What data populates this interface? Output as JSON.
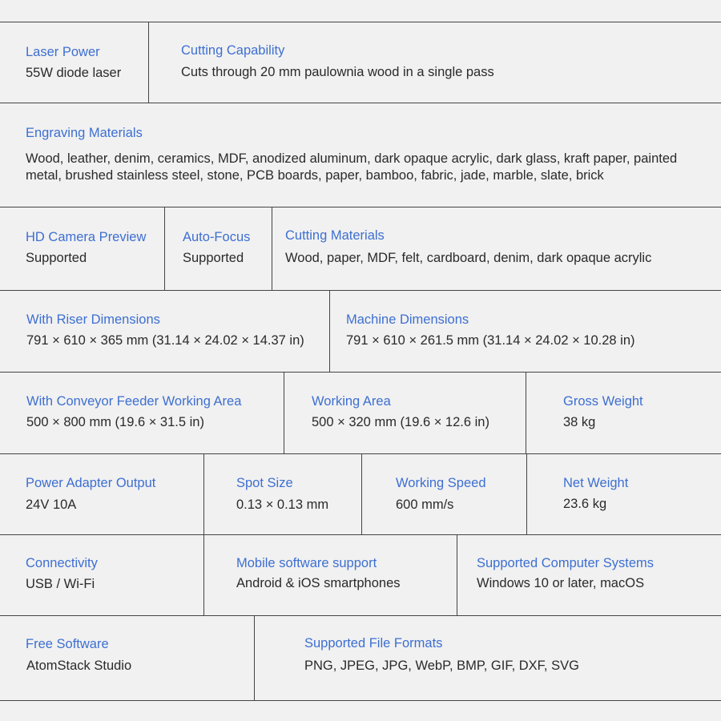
{
  "rows": [
    {
      "cells": [
        {
          "label": "Laser Power",
          "value": "55W diode laser"
        },
        {
          "label": "Cutting Capability",
          "value": "Cuts through 20 mm paulownia wood in a single pass"
        }
      ]
    },
    {
      "cells": [
        {
          "label": "Engraving Materials",
          "value": "Wood, leather, denim, ceramics, MDF, anodized aluminum, dark opaque acrylic, dark glass, kraft paper, painted metal, brushed stainless steel, stone, PCB boards, paper, bamboo, fabric, jade, marble, slate, brick"
        }
      ]
    },
    {
      "cells": [
        {
          "label": "HD Camera Preview",
          "value": "Supported"
        },
        {
          "label": "Auto-Focus",
          "value": "Supported"
        },
        {
          "label": "Cutting Materials",
          "value": "Wood, paper, MDF, felt, cardboard, denim, dark opaque acrylic"
        }
      ]
    },
    {
      "cells": [
        {
          "label": "With Riser Dimensions",
          "value": "791 × 610 × 365 mm (31.14 × 24.02 × 14.37 in)"
        },
        {
          "label": "Machine Dimensions",
          "value": "791 × 610 × 261.5 mm (31.14 × 24.02 × 10.28 in)"
        }
      ]
    },
    {
      "cells": [
        {
          "label": "With Conveyor Feeder Working Area",
          "value": "500 × 800 mm (19.6 × 31.5 in)"
        },
        {
          "label": "Working Area",
          "value": "500 × 320 mm (19.6 × 12.6 in)"
        },
        {
          "label": "Gross Weight",
          "value": "38 kg"
        }
      ]
    },
    {
      "cells": [
        {
          "label": "Power Adapter Output",
          "value": "24V 10A"
        },
        {
          "label": "Spot Size",
          "value": "0.13 × 0.13 mm"
        },
        {
          "label": "Working Speed",
          "value": "600 mm/s"
        },
        {
          "label": "Net Weight",
          "value": "23.6 kg"
        }
      ]
    },
    {
      "cells": [
        {
          "label": "Connectivity",
          "value": "USB / Wi-Fi"
        },
        {
          "label": "Mobile software support",
          "value": "Android & iOS smartphones"
        },
        {
          "label": "Supported Computer Systems",
          "value": "Windows 10 or later, macOS"
        }
      ]
    },
    {
      "cells": [
        {
          "label": "Free Software",
          "value": "AtomStack Studio"
        },
        {
          "label": "Supported File Formats",
          "value": "PNG, JPEG, JPG, WebP, BMP, GIF, DXF, SVG"
        }
      ]
    }
  ],
  "colors": {
    "label": "#3d6fd1",
    "value": "#2a2a2a",
    "background": "#f1f1f1",
    "border": "#444444"
  }
}
